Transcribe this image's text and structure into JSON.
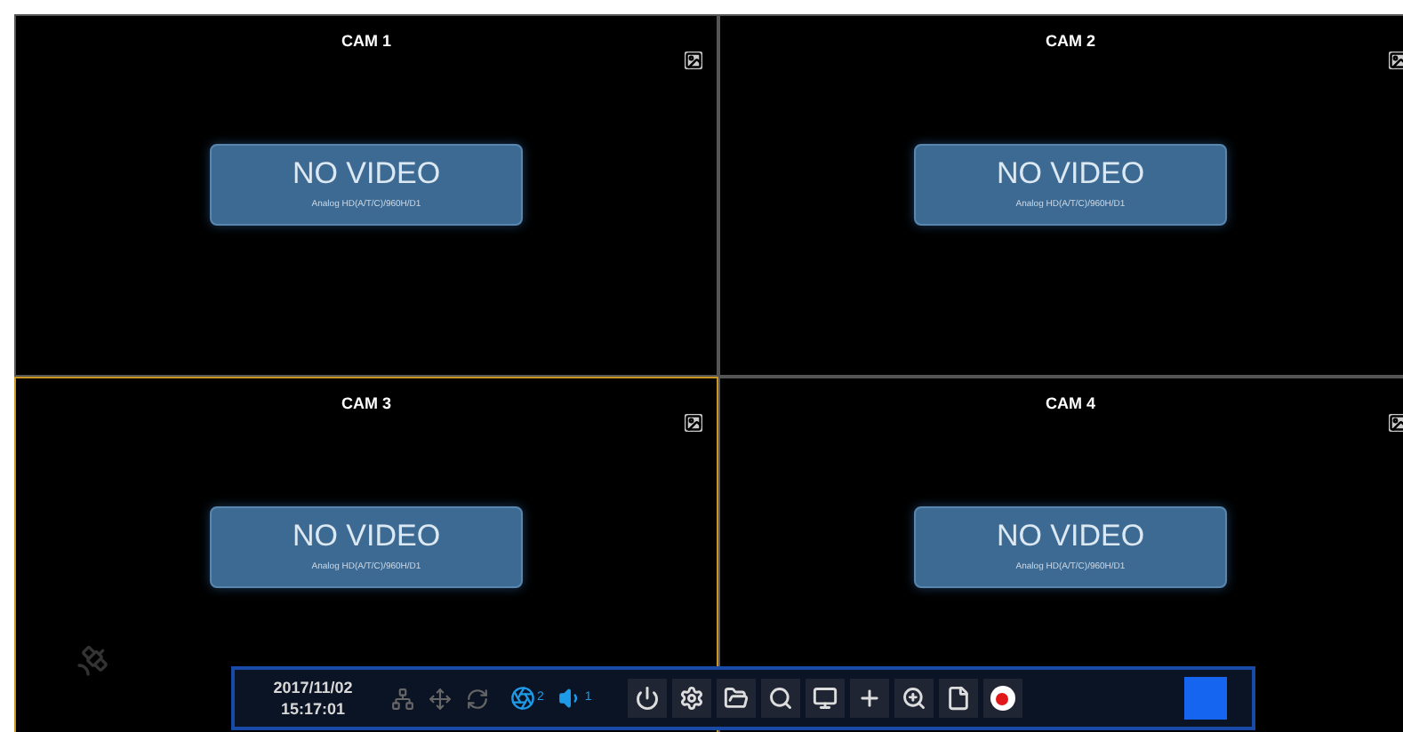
{
  "cameras": [
    {
      "title": "CAM 1",
      "selected": false,
      "status": "NO VIDEO",
      "subtitle": "Analog HD(A/T/C)/960H/D1"
    },
    {
      "title": "CAM 2",
      "selected": false,
      "status": "NO VIDEO",
      "subtitle": "Analog HD(A/T/C)/960H/D1"
    },
    {
      "title": "CAM 3",
      "selected": true,
      "status": "NO VIDEO",
      "subtitle": "Analog HD(A/T/C)/960H/D1"
    },
    {
      "title": "CAM 4",
      "selected": false,
      "status": "NO VIDEO",
      "subtitle": "Analog HD(A/T/C)/960H/D1"
    }
  ],
  "toolbar": {
    "date": "2017/11/02",
    "time": "15:17:01",
    "camera_count": "2",
    "audio_count": "1"
  }
}
